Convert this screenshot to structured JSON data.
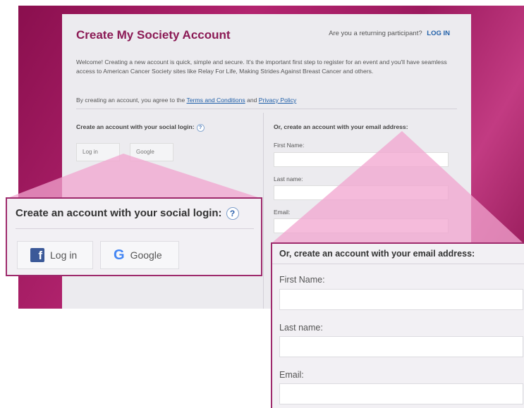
{
  "colors": {
    "brand": "#8b1a55",
    "link": "#1f5fa8",
    "highlight_border": "#9e2a6c",
    "background_magenta": "#9c1a5e"
  },
  "card": {
    "title": "Create My Society Account",
    "returning_prompt": "Are you a returning participant?",
    "login_link": "LOG IN",
    "welcome_text": "Welcome! Creating a new account is quick, simple and secure. It's the important first step to register for an event and you'll have seamless access to American Cancer Society sites like Relay For Life, Making Strides Against Breast Cancer and others.",
    "agree_prefix": "By creating an account, you agree to the",
    "terms_link": "Terms and Conditions",
    "agree_and": "and",
    "privacy_link": "Privacy Policy"
  },
  "social": {
    "heading": "Create an account with your social login:",
    "help_icon": "?",
    "facebook_label": "Log in",
    "facebook_icon": "f",
    "google_label": "Google",
    "google_icon": "G"
  },
  "email_form": {
    "heading": "Or, create an account with your email address:",
    "first_name_label": "First Name:",
    "last_name_label": "Last name:",
    "email_label": "Email:"
  },
  "zoom_email_form": {
    "heading": "Or, create an account with your email address:",
    "first_name_label": "First Name:",
    "last_name_label": "Last name:",
    "email_label": "Email:"
  }
}
